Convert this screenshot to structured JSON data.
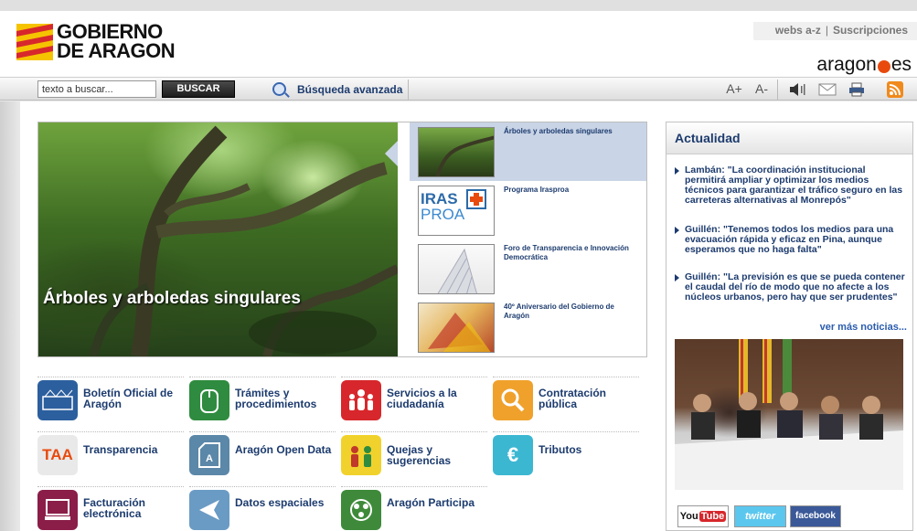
{
  "header": {
    "logo_line1": "GOBIERNO",
    "logo_line2": "DE ARAGON",
    "links": [
      "webs a-z",
      "Suscripciones"
    ],
    "links_separator": "|",
    "portal_left": "aragon",
    "portal_right": "es"
  },
  "search": {
    "value": "texto a buscar...",
    "button_label": "BUSCAR",
    "advanced_label": "Búsqueda avanzada"
  },
  "tools": {
    "font_increase": "A+",
    "font_decrease": "A-",
    "icons": [
      "speaker-icon",
      "mail-icon",
      "print-icon",
      "rss-icon"
    ]
  },
  "slider": {
    "hero_caption": "Árboles y arboledas singulares",
    "thumbs": [
      {
        "label": "Árboles y arboledas singulares",
        "active": true
      },
      {
        "label": "Programa Irasproa",
        "active": false
      },
      {
        "label": "Foro de Transparencia e Innovación Democrática",
        "active": false
      },
      {
        "label": "40º Aniversario del Gobierno de Aragón",
        "active": false
      }
    ],
    "irasproa_logo_line1": "IRAS",
    "irasproa_logo_line2": "PROA"
  },
  "services": [
    {
      "label": "Boletín Oficial de Aragón",
      "icon": "boa-icon",
      "color": "#2c5f9e"
    },
    {
      "label": "Trámites y procedimientos",
      "icon": "mouse-icon",
      "color": "#2e8b3f"
    },
    {
      "label": "Servicios a la ciudadanía",
      "icon": "people-icon",
      "color": "#d7272c"
    },
    {
      "label": "Contratación pública",
      "icon": "magnifier-icon",
      "color": "#f0a12b"
    },
    {
      "label": "Transparencia",
      "icon": "taa-icon",
      "color": "#e9e9e9",
      "icon_text": "TAA"
    },
    {
      "label": "Aragón Open Data",
      "icon": "open-data-icon",
      "color": "#5b87a8"
    },
    {
      "label": "Quejas y sugerencias",
      "icon": "complaints-icon",
      "color": "#f1d22c"
    },
    {
      "label": "Tributos",
      "icon": "euro-icon",
      "color": "#3cb7d2",
      "icon_text": "€"
    },
    {
      "label": "Facturación electrónica",
      "icon": "computer-icon",
      "color": "#8a1e48"
    },
    {
      "label": "Datos espaciales",
      "icon": "spatial-data-icon",
      "color": "#6a9bc4"
    },
    {
      "label": "Aragón Participa",
      "icon": "participa-icon",
      "color": "#3e8a3a"
    }
  ],
  "news": {
    "title": "Actualidad",
    "items": [
      "Lambán: \"La coordinación institucional permitirá ampliar y optimizar los medios técnicos para garantizar el tráfico seguro en las carreteras alternativas al Monrepós\"",
      "Guillén: \"Tenemos todos los medios para una evacuación rápida y eficaz en Pina, aunque esperamos que no haga falta\"",
      "Guillén: \"La previsión es que se pueda contener el caudal del río de modo que no afecte a los núcleos urbanos, pero hay que ser prudentes\""
    ],
    "more_label": "ver más noticias..."
  },
  "social": {
    "youtube_left": "You",
    "youtube_right": "Tube",
    "twitter": "twitter",
    "facebook": "facebook"
  }
}
